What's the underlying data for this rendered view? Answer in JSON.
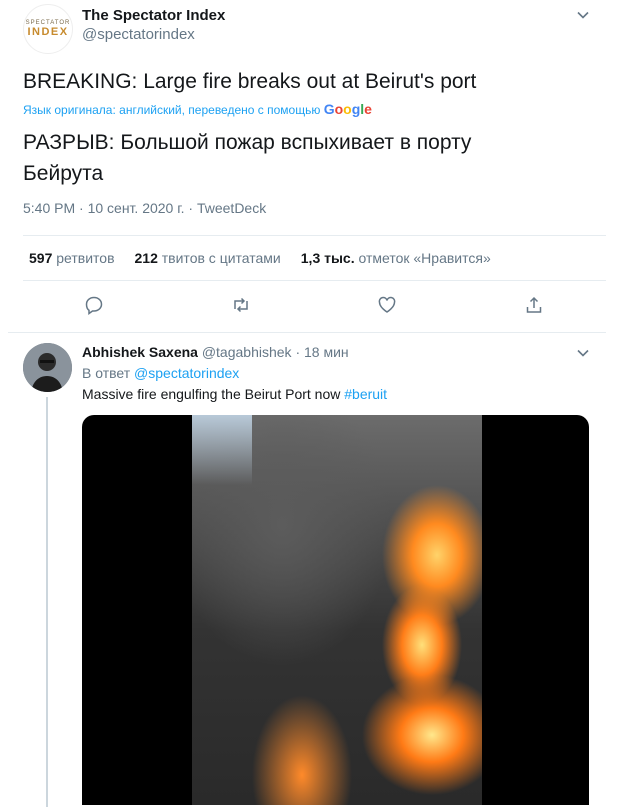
{
  "main_tweet": {
    "logo_line1": "SPECTATOR",
    "logo_line2": "INDEX",
    "author_name": "The Spectator Index",
    "author_handle": "@spectatorindex",
    "original_text": "BREAKING: Large fire breaks out at Beirut's port",
    "translation_note": "Язык оригинала: английский, переведено с помощью",
    "google_label": "Google",
    "translated_text": "РАЗРЫВ: Большой пожар вспыхивает в порту Бейрута",
    "meta": "5:40 PM · 10 сент. 2020 г. · TweetDeck",
    "stats": {
      "retweets_count": "597",
      "retweets_label": "ретвитов",
      "quotes_count": "212",
      "quotes_label": "твитов с цитатами",
      "likes_count": "1,3 тыс.",
      "likes_label": "отметок «Нравится»"
    },
    "actions": [
      "reply-icon",
      "retweet-icon",
      "like-icon",
      "share-icon"
    ]
  },
  "reply_tweet": {
    "author_name": "Abhishek Saxena",
    "author_handle": "@tagabhishek",
    "time": "18 мин",
    "reply_prefix": "В ответ",
    "reply_to": "@spectatorindex",
    "text": "Massive fire engulfing the Beirut Port now",
    "hashtag": "#beruit"
  },
  "colors": {
    "accent": "#1da1f2",
    "secondary_text": "#657786",
    "divider": "#e6ecf0"
  }
}
